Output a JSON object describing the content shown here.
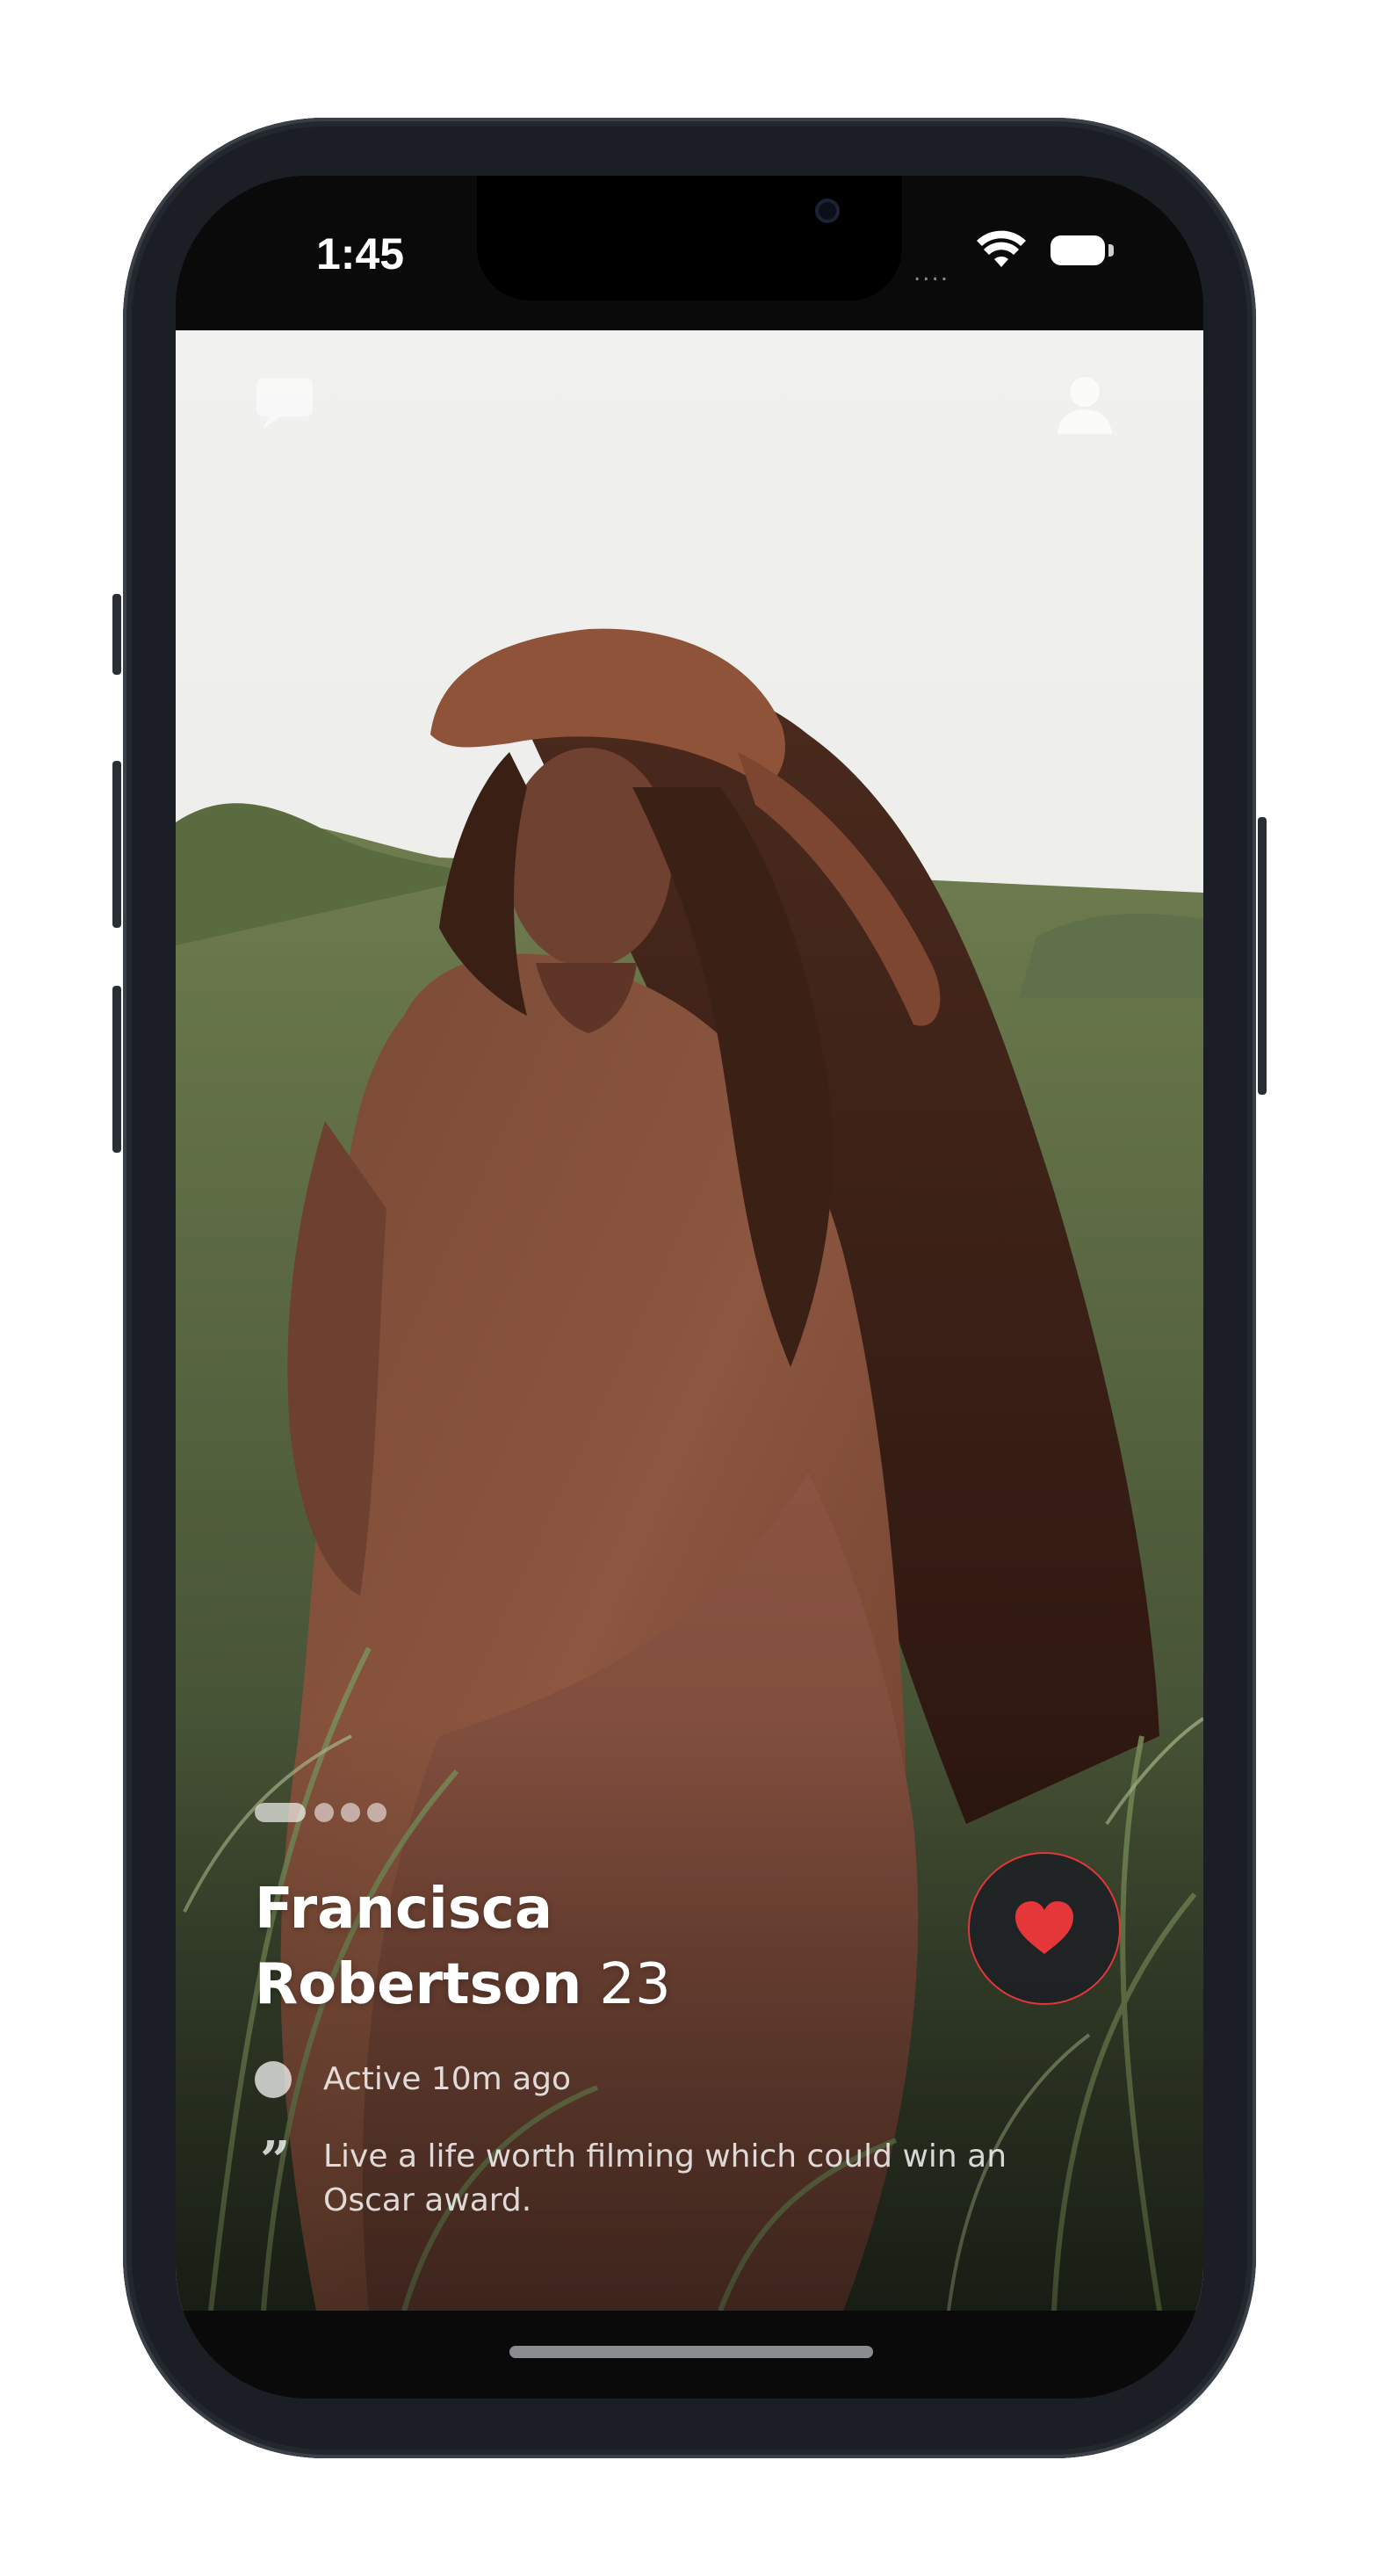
{
  "status_bar": {
    "time": "1:45",
    "signal_glyph": "....",
    "icons": [
      "signal-icon",
      "wifi-icon",
      "battery-icon"
    ]
  },
  "top_actions": {
    "left_icon": "chat-icon",
    "right_icon": "profile-icon"
  },
  "profile": {
    "first_name": "Francisca",
    "last_name": "Robertson",
    "age": "23",
    "status": "Active 10m ago",
    "bio": "Live a life worth filming which could win an Oscar award.",
    "photo_count": 4,
    "current_photo": 1
  },
  "actions": {
    "like_icon": "heart-icon"
  },
  "colors": {
    "accent": "#E5363A",
    "background": "#0A0A0B"
  }
}
